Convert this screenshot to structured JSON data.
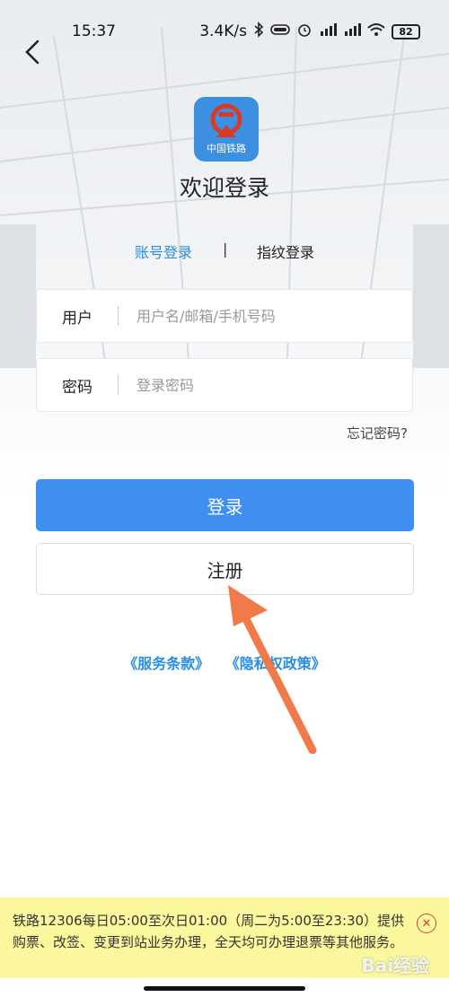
{
  "status_bar": {
    "time": "15:37",
    "net_speed": "3.4K/s",
    "battery": "82",
    "icons": [
      "bluetooth-icon",
      "hd-icon",
      "alarm-icon",
      "signal-icon",
      "signal-icon",
      "wifi-icon",
      "battery-icon"
    ]
  },
  "header": {
    "logo_caption": "中国铁路",
    "welcome": "欢迎登录"
  },
  "tabs": {
    "account_login": "账号登录",
    "separator": "|",
    "fingerprint_login": "指纹登录",
    "active": "account_login"
  },
  "form": {
    "user_label": "用户",
    "user_placeholder": "用户名/邮箱/手机号码",
    "password_label": "密码",
    "password_placeholder": "登录密码",
    "forgot": "忘记密码?"
  },
  "buttons": {
    "login": "登录",
    "register": "注册"
  },
  "links": {
    "terms": "《服务条款》",
    "privacy": "《隐私权政策》"
  },
  "notice": {
    "text": "铁路12306每日05:00至次日01:00（周二为5:00至23:30）提供购票、改签、变更到站业务办理，全天均可办理退票等其他服务。"
  },
  "watermark": "Bai经验",
  "colors": {
    "accent": "#3e8ff0",
    "link": "#2a8ee0",
    "notice_bg": "#fbf79d",
    "arrow": "#f07a4a"
  }
}
